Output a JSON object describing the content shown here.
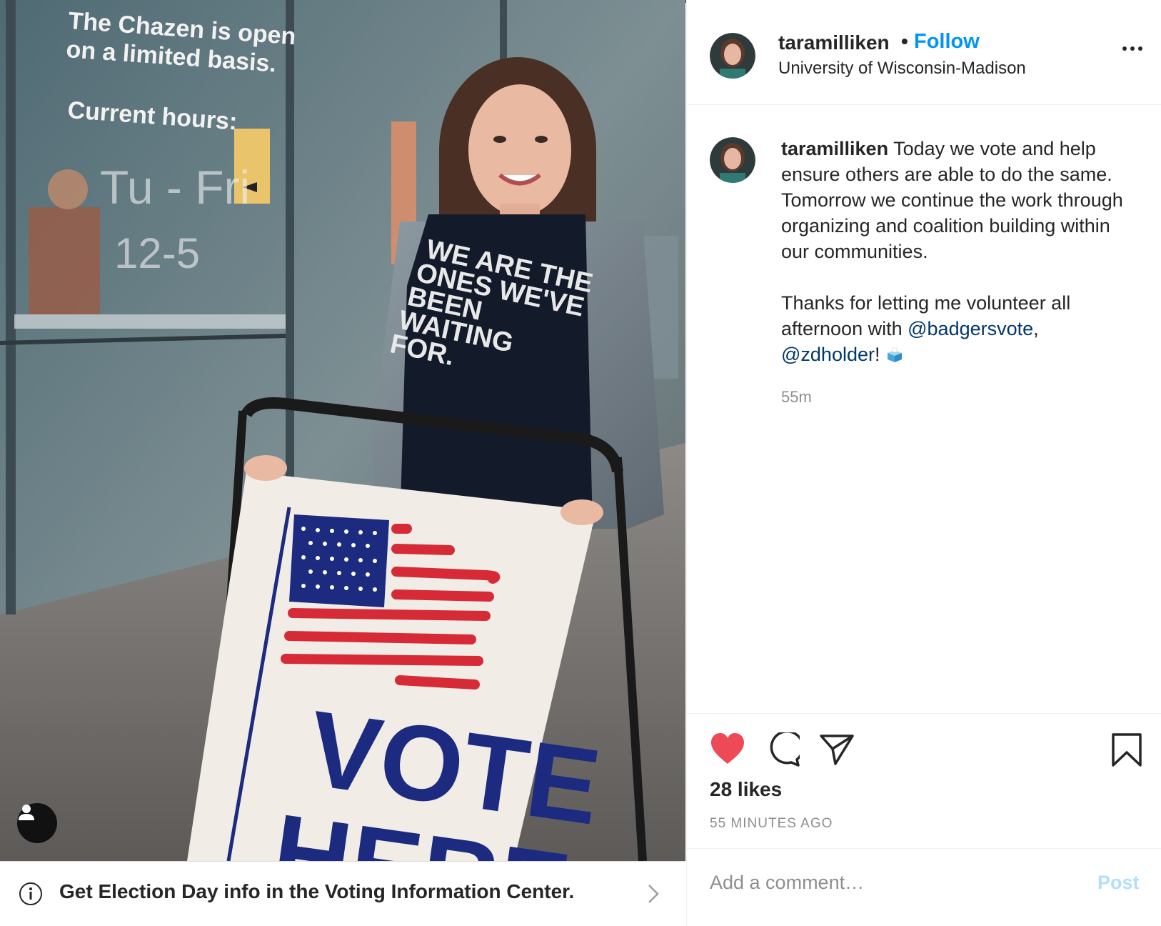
{
  "post": {
    "username": "taramilliken",
    "follow_label": "Follow",
    "dot": "•",
    "location": "University of Wisconsin-Madison",
    "caption": {
      "username": "taramilliken",
      "line_before": "Today we vote and help ensure others are able to do the same. Tomorrow we continue the work through organizing and coalition building within our communities.",
      "thanks_text": "Thanks for letting me volunteer all afternoon with",
      "mention1": "@badgersvote",
      "comma": ",",
      "mention2": "@zdholder",
      "exclaim": "!",
      "time": "55m"
    },
    "likes": "28 likes",
    "time_ago": "55 MINUTES AGO",
    "comment_placeholder": "Add a comment…",
    "post_label": "Post"
  },
  "photo": {
    "sign_lines": [
      "The Chazen is open",
      "on a limited basis.",
      "Current hours:",
      "Tu - Fri",
      "12-5"
    ],
    "shirt_lines": [
      "WE ARE THE",
      "ONES WE'VE",
      "BEEN",
      "WAITING",
      "FOR."
    ],
    "board_text": [
      "VOTE",
      "HERE"
    ]
  },
  "info_bar": {
    "text": "Get Election Day info in the Voting Information Center."
  },
  "colors": {
    "follow": "#0095f6",
    "heart": "#ed4956",
    "mention": "#00376b",
    "post_disabled": "#b2dffc"
  },
  "icons": [
    "info-icon",
    "chevron-right-icon",
    "heart-icon",
    "comment-icon",
    "share-icon",
    "bookmark-icon",
    "more-icon",
    "user-tag-icon"
  ]
}
